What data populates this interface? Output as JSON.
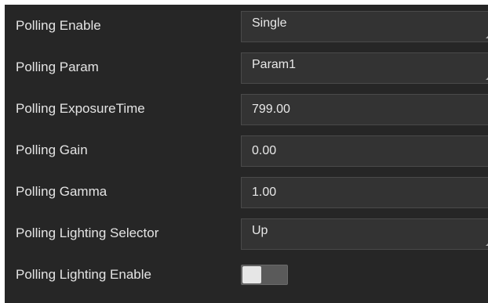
{
  "properties": {
    "polling_enable": {
      "label": "Polling Enable",
      "value": "Single"
    },
    "polling_param": {
      "label": "Polling Param",
      "value": "Param1"
    },
    "polling_exposure_time": {
      "label": "Polling ExposureTime",
      "value": "799.00"
    },
    "polling_gain": {
      "label": "Polling Gain",
      "value": "0.00"
    },
    "polling_gamma": {
      "label": "Polling Gamma",
      "value": "1.00"
    },
    "polling_lighting_selector": {
      "label": "Polling Lighting Selector",
      "value": "Up"
    },
    "polling_lighting_enable": {
      "label": "Polling Lighting Enable",
      "state": "off"
    }
  },
  "colors": {
    "panel_background": "#262626",
    "field_background": "#333333",
    "text": "#e4e4e4",
    "toggle_track": "#5a5a5a",
    "toggle_knob": "#e6e6e6"
  }
}
